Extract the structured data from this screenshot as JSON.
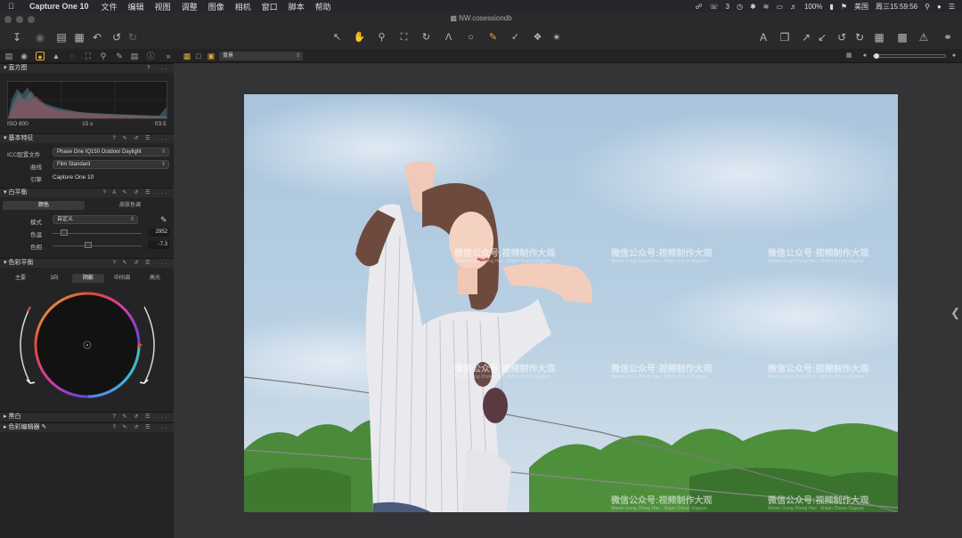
{
  "menubar": {
    "app_name": "Capture One 10",
    "items": [
      "文件",
      "编辑",
      "视图",
      "调整",
      "图像",
      "相机",
      "窗口",
      "脚本",
      "帮助"
    ],
    "status_badge": "3",
    "battery": "100%",
    "input_method": "美国",
    "clock": "周三15:59:56"
  },
  "window": {
    "title": "NW.cosessiondb"
  },
  "layer": {
    "selected": "背景"
  },
  "histogram": {
    "title": "直方图",
    "iso": "ISO 800",
    "shutter": "15 s",
    "aperture": "f/3.5"
  },
  "basic": {
    "title": "基本特征",
    "icc_label": "ICC配置文件",
    "icc_value": "Phase One IQ150 Outdoor Daylight",
    "curve_label": "曲线",
    "curve_value": "Film Standard",
    "engine_label": "引擎",
    "engine_value": "Capture One 10"
  },
  "white_balance": {
    "title": "白平衡",
    "tab_color": "颜色",
    "tab_skin": "皮肤色调",
    "mode_label": "模式",
    "mode_value": "自定义",
    "kelvin_label": "色温",
    "kelvin_value": "2952",
    "tint_label": "色相",
    "tint_value": "-7.3"
  },
  "color_balance": {
    "title": "色彩平衡",
    "tabs": [
      "主要",
      "3向",
      "阴影",
      "中间调",
      "高光"
    ],
    "active_tab": "阴影"
  },
  "bw": {
    "title": "黑白"
  },
  "color_editor": {
    "title": "色彩编辑器"
  },
  "watermark": {
    "text": "微信公众号:视频制作大观",
    "sub": "Weixin Gong Zhong Hao : Shipin Zhizuo Daguan"
  }
}
